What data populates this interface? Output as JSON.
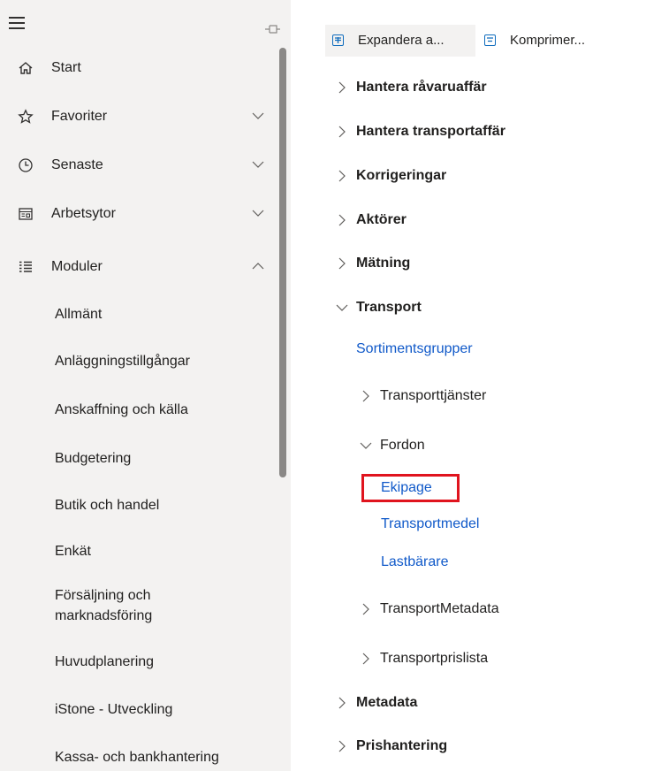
{
  "nav": {
    "items": [
      {
        "label": "Start",
        "icon": "home-icon"
      },
      {
        "label": "Favoriter",
        "icon": "star-icon"
      },
      {
        "label": "Senaste",
        "icon": "clock-icon"
      },
      {
        "label": "Arbetsytor",
        "icon": "workspace-icon"
      },
      {
        "label": "Moduler",
        "icon": "modules-list-icon"
      }
    ],
    "modules": [
      "Allmänt",
      "Anläggningstillgångar",
      "Anskaffning och källa",
      "Budgetering",
      "Butik och handel",
      "Enkät",
      "Försäljning och marknadsföring",
      "Huvudplanering",
      "iStone - Utveckling",
      "Kassa- och bankhantering"
    ]
  },
  "toolbar": {
    "expand_label": "Expandera a...",
    "collapse_label": "Komprimer..."
  },
  "tree": {
    "top": [
      "Hantera råvaruaffär",
      "Hantera transportaffär",
      "Korrigeringar",
      "Aktörer",
      "Mätning",
      "Transport"
    ],
    "transport_link": "Sortimentsgrupper",
    "transport_children": [
      "Transporttjänster",
      "Fordon"
    ],
    "fordon_links": [
      "Ekipage",
      "Transportmedel",
      "Lastbärare"
    ],
    "more_children": [
      "TransportMetadata",
      "Transportprislista"
    ],
    "bottom": [
      "Metadata",
      "Prishantering"
    ]
  },
  "colors": {
    "accent": "#0f6cbd",
    "link": "#1059c9",
    "highlight": "#e0141e",
    "nav_bg": "#f3f2f1"
  }
}
